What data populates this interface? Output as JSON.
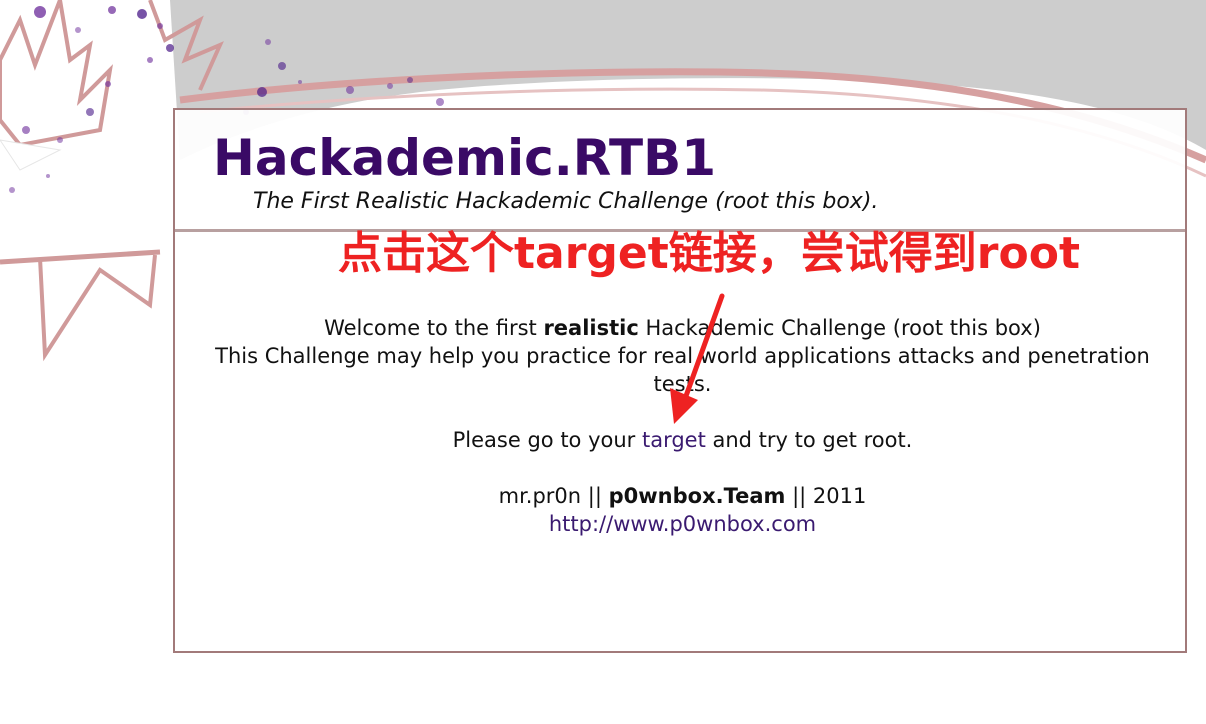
{
  "header": {
    "title": "Hackademic.RTB1",
    "subtitle": "The First Realistic Hackademic Challenge (root this box)."
  },
  "annotation": {
    "text": "点击这个target链接，尝试得到root",
    "color": "#ee2222"
  },
  "content": {
    "welcome_prefix": "Welcome to the first ",
    "welcome_bold": "realistic",
    "welcome_suffix": " Hackademic Challenge (root this box)",
    "line2": "This Challenge may help you practice for real world applications attacks and penetration tests.",
    "please_prefix": "Please go to your ",
    "target_link": "target",
    "please_suffix": " and try to get root.",
    "credit_prefix": "mr.pr0n || ",
    "credit_bold": "p0wnbox.Team",
    "credit_suffix": " || 2011",
    "site_link": "http://www.p0wnbox.com"
  },
  "colors": {
    "title": "#3a0a66",
    "link": "#3a1a70",
    "frame_border": "#a27a7a"
  }
}
